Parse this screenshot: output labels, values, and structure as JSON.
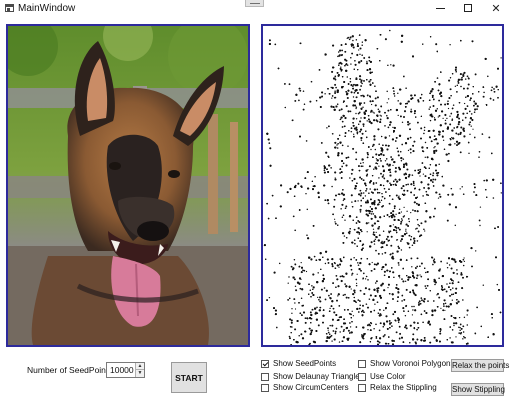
{
  "window": {
    "title": "MainWindow",
    "close_glyph": "✕",
    "icons": [
      "app-icon",
      "minimize-icon",
      "maximize-icon",
      "close-icon"
    ]
  },
  "controls": {
    "seed_label": "Number of SeedPoints:",
    "seed_value": "10000",
    "start_label": "START"
  },
  "options": {
    "show_seedpoints": {
      "label": "Show SeedPoints",
      "checked": true
    },
    "show_delaunay": {
      "label": "Show Delaunay Triangles",
      "checked": false
    },
    "show_circumcenters": {
      "label": "Show CircumCenters",
      "checked": false
    },
    "show_voronoi": {
      "label": "Show Voronoi Polygons",
      "checked": false
    },
    "use_color": {
      "label": "Use Color",
      "checked": false
    },
    "relax_stippling": {
      "label": "Relax the Stippling",
      "checked": false
    }
  },
  "buttons": {
    "relax_points": "Relax the points",
    "show_stippling": "Show Stippling"
  },
  "colors": {
    "panel_border": "#2d2a9c",
    "button_face": "#e1e1e1"
  }
}
